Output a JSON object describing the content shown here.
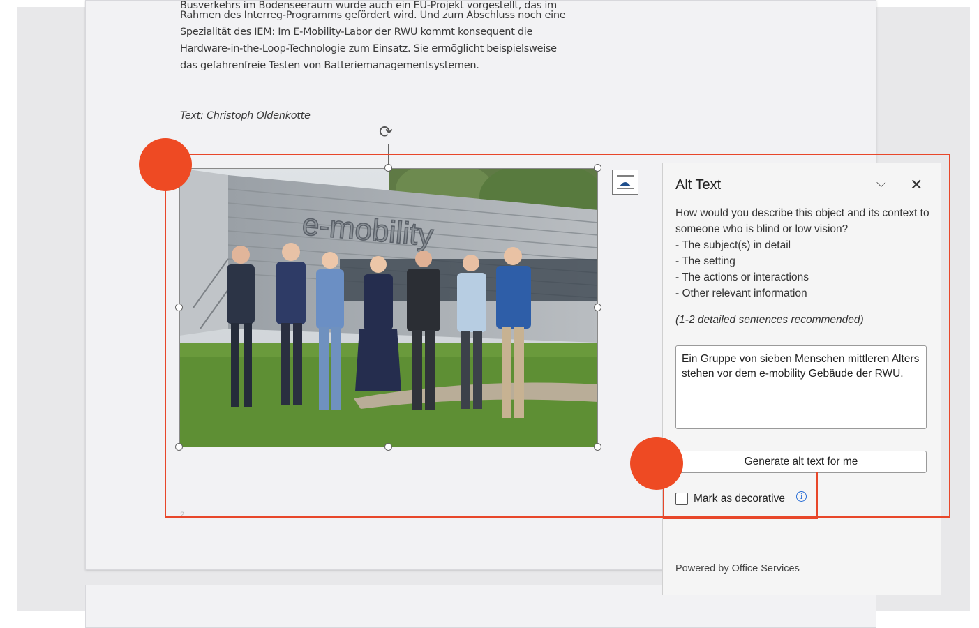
{
  "document": {
    "lines": [
      "Busverkehrs im Bodenseeraum wurde auch ein EU-Projekt vorgestellt, das im",
      "Rahmen des Interreg-Programms gefördert wird. Und zum Abschluss noch eine",
      "Spezialität des IEM: Im E-Mobility-Labor der RWU kommt konsequent die",
      "Hardware-in-the-Loop-Technologie zum Einsatz. Sie ermöglicht beispielsweise",
      "das gefahrenfreie Testen von Batteriemanagementsystemen."
    ],
    "credit": "Text: Christoph Oldenkotte",
    "page_number": "2"
  },
  "photo": {
    "sign_text": "e-mobility"
  },
  "alt_text_panel": {
    "title": "Alt Text",
    "description_lines": [
      "How would you describe this object and its context to someone who is blind or low vision?",
      "- The subject(s) in detail",
      "- The setting",
      "- The actions or interactions",
      "- Other relevant information"
    ],
    "hint": "(1-2 detailed sentences recommended)",
    "textarea_value": "Ein Gruppe von sieben Menschen mittleren Alters stehen vor dem e-mobility Gebäude der RWU.",
    "generate_button": "Generate alt text for me",
    "decorative_label": "Mark as decorative",
    "decorative_checked": false,
    "footer": "Powered by Office Services"
  },
  "colors": {
    "highlight": "#e8472a",
    "marker_dot": "#ee4a23",
    "info_icon": "#2b6fd6"
  }
}
